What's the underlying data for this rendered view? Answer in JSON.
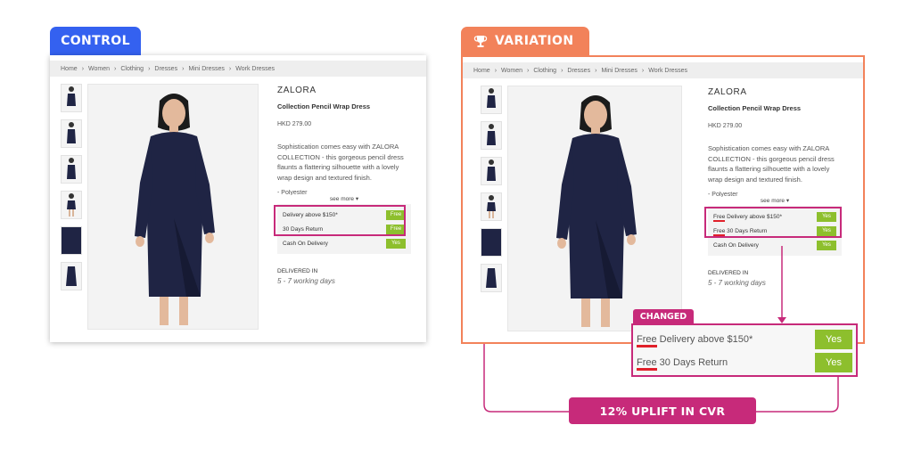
{
  "control": {
    "tag": "CONTROL",
    "breadcrumb": [
      "Home",
      "Women",
      "Clothing",
      "Dresses",
      "Mini Dresses",
      "Work Dresses"
    ],
    "brand": "ZALORA",
    "product_name": "Collection Pencil Wrap Dress",
    "price": "HKD 279.00",
    "description": "Sophistication comes easy with ZALORA COLLECTION - this gorgeous pencil dress flaunts a flattering silhouette with a lovely wrap design and textured finish.",
    "fabric": "- Polyester",
    "see_more": "see more",
    "benefits": [
      {
        "label": "Delivery above $150*",
        "value": "Free"
      },
      {
        "label": "30 Days Return",
        "value": "Free"
      },
      {
        "label": "Cash On Delivery",
        "value": "Yes"
      }
    ],
    "delivered_title": "DELIVERED IN",
    "delivered_days": "5 - 7 working days"
  },
  "variation": {
    "tag": "VARIATION",
    "breadcrumb": [
      "Home",
      "Women",
      "Clothing",
      "Dresses",
      "Mini Dresses",
      "Work Dresses"
    ],
    "brand": "ZALORA",
    "product_name": "Collection Pencil Wrap Dress",
    "price": "HKD 279.00",
    "description": "Sophistication comes easy with ZALORA COLLECTION - this gorgeous pencil dress flaunts a flattering silhouette with a lovely wrap design and textured finish.",
    "fabric": "- Polyester",
    "see_more": "see more",
    "benefits": [
      {
        "prefix": "Free",
        "label": " Delivery above $150*",
        "value": "Yes"
      },
      {
        "prefix": "Free",
        "label": " 30 Days Return",
        "value": "Yes"
      },
      {
        "prefix": "",
        "label": "Cash On Delivery",
        "value": "Yes"
      }
    ],
    "delivered_title": "DELIVERED IN",
    "delivered_days": "5 - 7 working days"
  },
  "changed": {
    "tag": "CHANGED",
    "rows": [
      {
        "prefix": "Free",
        "label": " Delivery above $150*",
        "value": "Yes"
      },
      {
        "prefix": "Free",
        "label": " 30 Days Return",
        "value": "Yes"
      }
    ]
  },
  "result": "12% UPLIFT IN CVR",
  "colors": {
    "control": "#3461f0",
    "variation": "#f2825a",
    "highlight": "#c72a7a",
    "button": "#8dbf2d",
    "underline": "#e0202a"
  },
  "icons": [
    "trophy-icon",
    "dress-model-image"
  ]
}
